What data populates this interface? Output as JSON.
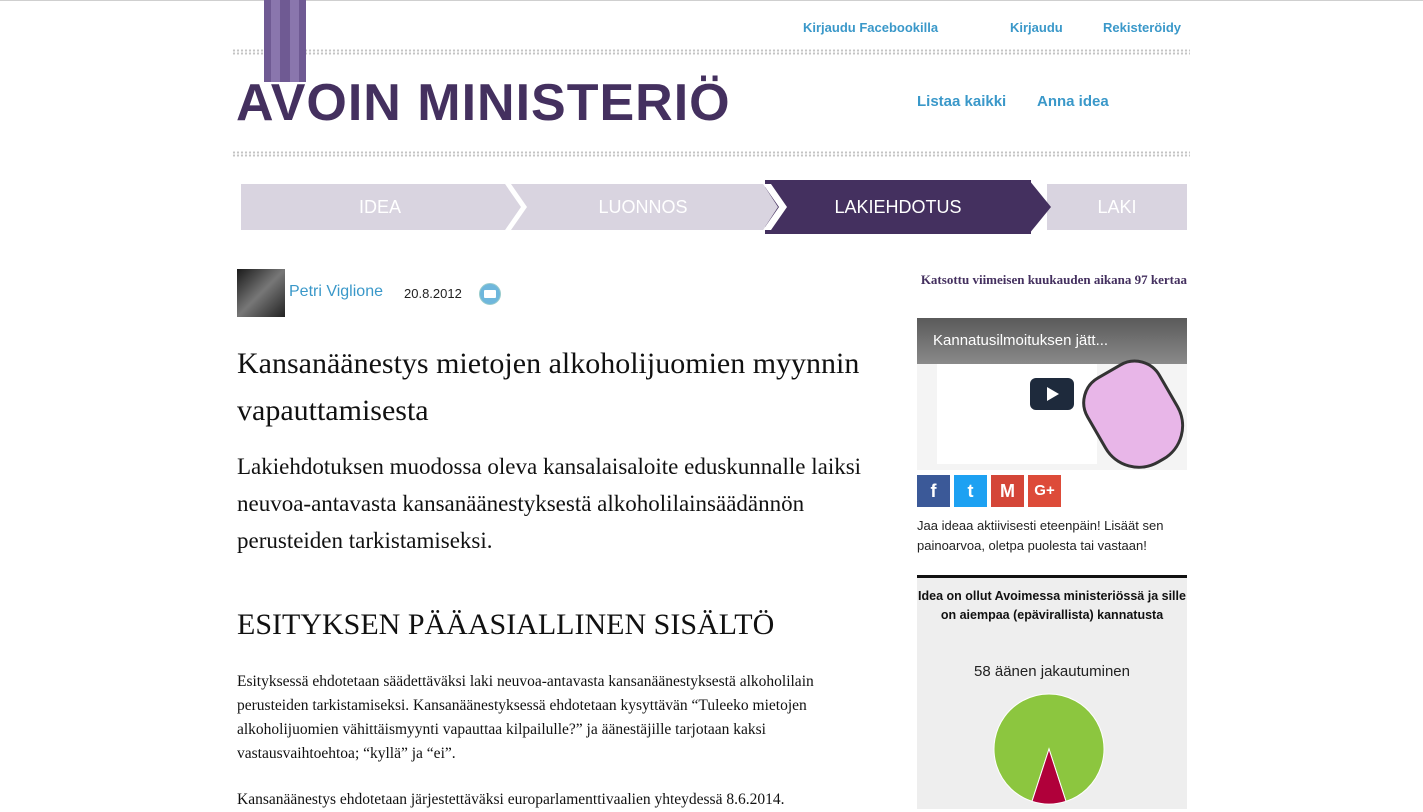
{
  "header": {
    "top_links": [
      "Kirjaudu Facebookilla",
      "Kirjaudu",
      "Rekisteröidy"
    ],
    "logo_text": "AVOIN MINISTERIÖ",
    "nav_links": [
      "Listaa kaikki",
      "Anna idea"
    ]
  },
  "steps": [
    {
      "label": "IDEA",
      "active": false
    },
    {
      "label": "LUONNOS",
      "active": false
    },
    {
      "label": "LAKIEHDOTUS",
      "active": true
    },
    {
      "label": "LAKI",
      "active": false
    }
  ],
  "author": {
    "name": "Petri Viglione",
    "date": "20.8.2012"
  },
  "views_text": "Katsottu viimeisen kuukauden aikana 97 kertaa",
  "content": {
    "title": "Kansanäänestys mietojen alkoholijuomien myynnin vapauttamisesta",
    "lead": "Lakiehdotuksen muodossa oleva kansalaisaloite eduskunnalle laiksi neuvoa-antavasta kansanäänestyksestä alkoholilainsäädännön perusteiden tarkistamiseksi.",
    "section_heading": "ESITYKSEN PÄÄASIALLINEN SISÄLTÖ",
    "paragraphs": [
      "Esityksessä ehdotetaan säädettäväksi laki neuvoa-antavasta kansanäänestyksestä alkoholilain perusteiden tarkistamiseksi. Kansanäänestyksessä ehdotetaan kysyttävän “Tuleeko mietojen alkoholijuomien vähittäismyynti vapauttaa kilpailulle?” ja äänestäjille tarjotaan kaksi vastausvaihtoehtoa; “kyllä” ja “ei”.",
      "Kansanäänestys ehdotetaan järjestettäväksi europarlamenttivaalien yhteydessä 8.6.2014."
    ]
  },
  "sidebar": {
    "video_title": "Kannatusilmoituksen jätt...",
    "share_icons": [
      "facebook-icon",
      "twitter-icon",
      "gmail-icon",
      "google-plus-icon"
    ],
    "share_colors": [
      "#3b5998",
      "#1da1f2",
      "#d44638",
      "#dd4b39"
    ],
    "share_text": "Jaa ideaa aktiivisesti eteenpäin! Lisäät sen painoarvoa, oletpa puolesta tai vastaan!",
    "panel_heading": "Idea on ollut Avoimessa ministeriössä ja sille on aiempaa (epävirallista) kannatusta",
    "vote_summary": "58 äänen jakautuminen"
  },
  "colors": {
    "brand": "#44305f",
    "link": "#3a98c9",
    "for": "#8cc63f",
    "against": "#b0003a"
  },
  "chart_data": {
    "type": "pie",
    "slices": [
      {
        "value": 0.9
      },
      {
        "value": 0.1
      }
    ]
  }
}
